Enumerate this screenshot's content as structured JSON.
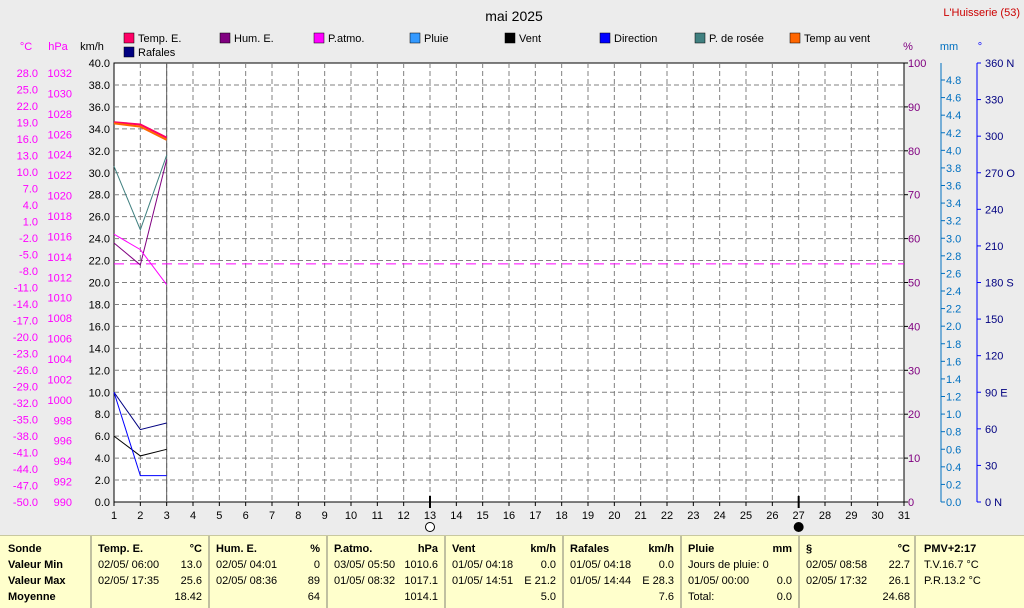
{
  "site": "L'Huisserie (53)",
  "chart_data": {
    "type": "line",
    "title": "mai 2025",
    "legend": [
      "Temp. E.",
      "Hum. E.",
      "P.atmo.",
      "Pluie",
      "Vent",
      "Direction",
      "P. de rosée",
      "Temp au vent",
      "Rafales"
    ],
    "legend_colors": [
      "#ff0066",
      "#800080",
      "#ff00ff",
      "#3399ff",
      "#000000",
      "#0000ff",
      "#408080",
      "#ff6600",
      "#000080"
    ],
    "x": [
      1,
      2,
      3,
      4,
      5,
      6,
      7,
      8,
      9,
      10,
      11,
      12,
      13,
      14,
      15,
      16,
      17,
      18,
      19,
      20,
      21,
      22,
      23,
      24,
      25,
      26,
      27,
      28,
      29,
      30,
      31
    ],
    "axes": {
      "temp_unit": "°C",
      "temp_ticks": [
        "25.0",
        "22.0",
        "19.0",
        "16.0",
        "13.0",
        "10.0",
        "7.0",
        "4.0",
        "1.0",
        "-2.0",
        "-5.0",
        "-8.0",
        "-11.0",
        "-14.0",
        "-17.0",
        "-20.0",
        "-23.0",
        "-26.0",
        "-29.0",
        "-32.0",
        "-35.0",
        "-38.0",
        "-41.0",
        "-44.0",
        "-47.0",
        "-50.0"
      ],
      "temp_top": "28.0",
      "press_unit": "hPa",
      "press_ticks": [
        "1032",
        "1030",
        "1028",
        "1026",
        "1024",
        "1022",
        "1020",
        "1018",
        "1016",
        "1014",
        "1012",
        "1010",
        "1008",
        "1006",
        "1004",
        "1002",
        "1000",
        "998",
        "996",
        "994",
        "992",
        "990"
      ],
      "wind_unit": "km/h",
      "wind_ticks": [
        "40.0",
        "38.0",
        "36.0",
        "34.0",
        "32.0",
        "30.0",
        "28.0",
        "26.0",
        "24.0",
        "22.0",
        "20.0",
        "18.0",
        "16.0",
        "14.0",
        "12.0",
        "10.0",
        "8.0",
        "6.0",
        "4.0",
        "2.0",
        "0.0"
      ],
      "hum_unit": "%",
      "hum_ticks": [
        "100",
        "90",
        "80",
        "70",
        "60",
        "50",
        "40",
        "30",
        "20",
        "10",
        "0"
      ],
      "rain_unit": "mm",
      "rain_ticks": [
        "4.8",
        "4.6",
        "4.4",
        "4.2",
        "4.0",
        "3.8",
        "3.6",
        "3.4",
        "3.2",
        "3.0",
        "2.8",
        "2.6",
        "2.4",
        "2.2",
        "2.0",
        "1.8",
        "1.6",
        "1.4",
        "1.2",
        "1.0",
        "0.8",
        "0.6",
        "0.4",
        "0.2",
        "0.0"
      ],
      "dir_unit": "°",
      "dir_ticks": [
        "360 N",
        "330",
        "300",
        "270 O",
        "240",
        "210",
        "180 S",
        "150",
        "120",
        "90  E",
        "60",
        "30",
        "0  N"
      ]
    },
    "series": [
      {
        "name": "Temp. E.",
        "color": "#ff0066",
        "axis": "wind",
        "x": [
          1,
          2,
          3
        ],
        "values": [
          34.6,
          34.4,
          33.2
        ]
      },
      {
        "name": "Temp au vent",
        "color": "#ff6600",
        "axis": "wind",
        "x": [
          1,
          2,
          3
        ],
        "values": [
          34.5,
          34.2,
          33.0
        ]
      },
      {
        "name": "Hum. E.",
        "color": "#800080",
        "axis": "wind",
        "x": [
          1,
          2,
          3
        ],
        "values": [
          23.6,
          21.6,
          31.2
        ]
      },
      {
        "name": "P.atmo.",
        "color": "#ff00ff",
        "axis": "wind",
        "x": [
          1,
          2,
          3
        ],
        "values": [
          24.4,
          23.0,
          19.8
        ]
      },
      {
        "name": "P. de rosée",
        "color": "#408080",
        "axis": "wind",
        "x": [
          1,
          2,
          3
        ],
        "values": [
          30.6,
          24.8,
          31.6
        ]
      },
      {
        "name": "Rafales",
        "color": "#000080",
        "axis": "wind",
        "x": [
          1,
          2,
          3
        ],
        "values": [
          10.0,
          6.6,
          7.2
        ]
      },
      {
        "name": "Vent",
        "color": "#000000",
        "axis": "wind",
        "x": [
          1,
          2,
          3
        ],
        "values": [
          6.0,
          4.2,
          4.8
        ]
      },
      {
        "name": "Direction",
        "color": "#0000ff",
        "axis": "wind",
        "x": [
          1,
          2,
          3
        ],
        "values": [
          10.0,
          2.4,
          2.4
        ]
      }
    ],
    "reference_line": {
      "value": 21.7,
      "axis": "wind",
      "color": "#ff00ff"
    },
    "moon_markers": [
      {
        "day": 13,
        "phase": "new"
      },
      {
        "day": 27,
        "phase": "full"
      }
    ],
    "grid": true
  },
  "summary": {
    "row_labels": [
      "Sonde",
      "Valeur Min",
      "Valeur Max",
      "Moyenne"
    ],
    "columns": [
      {
        "title": "Temp. E.",
        "unit": "°C",
        "min_date": "02/05/ 06:00",
        "min_val": "13.0",
        "max_date": "02/05/ 17:35",
        "max_val": "25.6",
        "avg": "18.42"
      },
      {
        "title": "Hum. E.",
        "unit": "%",
        "min_date": "02/05/ 04:01",
        "min_val": "0",
        "max_date": "02/05/ 08:36",
        "max_val": "89",
        "avg": "64"
      },
      {
        "title": "P.atmo.",
        "unit": "hPa",
        "min_date": "03/05/ 05:50",
        "min_val": "1010.6",
        "max_date": "01/05/ 08:32",
        "max_val": "1017.1",
        "avg": "1014.1"
      },
      {
        "title": "Vent",
        "unit": "km/h",
        "min_date": "01/05/ 04:18",
        "min_val": "0.0",
        "max_date": "01/05/ 14:51",
        "max_val": "E 21.2",
        "avg": "5.0"
      },
      {
        "title": "Rafales",
        "unit": "km/h",
        "min_date": "01/05/ 04:18",
        "min_val": "0.0",
        "max_date": "01/05/ 14:44",
        "max_val": "E 28.3",
        "avg": "7.6"
      },
      {
        "title": "Pluie",
        "unit": "mm",
        "min_date": "Jours de pluie: 0",
        "min_val": "",
        "max_date": "01/05/ 00:00",
        "max_val": "0.0",
        "avg_label": "Total:",
        "avg": "0.0"
      },
      {
        "title": "§",
        "unit": "°C",
        "min_date": "02/05/ 08:58",
        "min_val": "22.7",
        "max_date": "02/05/ 17:32",
        "max_val": "26.1",
        "avg": "24.68"
      }
    ],
    "pmv": {
      "title": "PMV+2:17",
      "line1": "T.V.16.7 °C",
      "line2": "P.R.13.2 °C"
    }
  }
}
